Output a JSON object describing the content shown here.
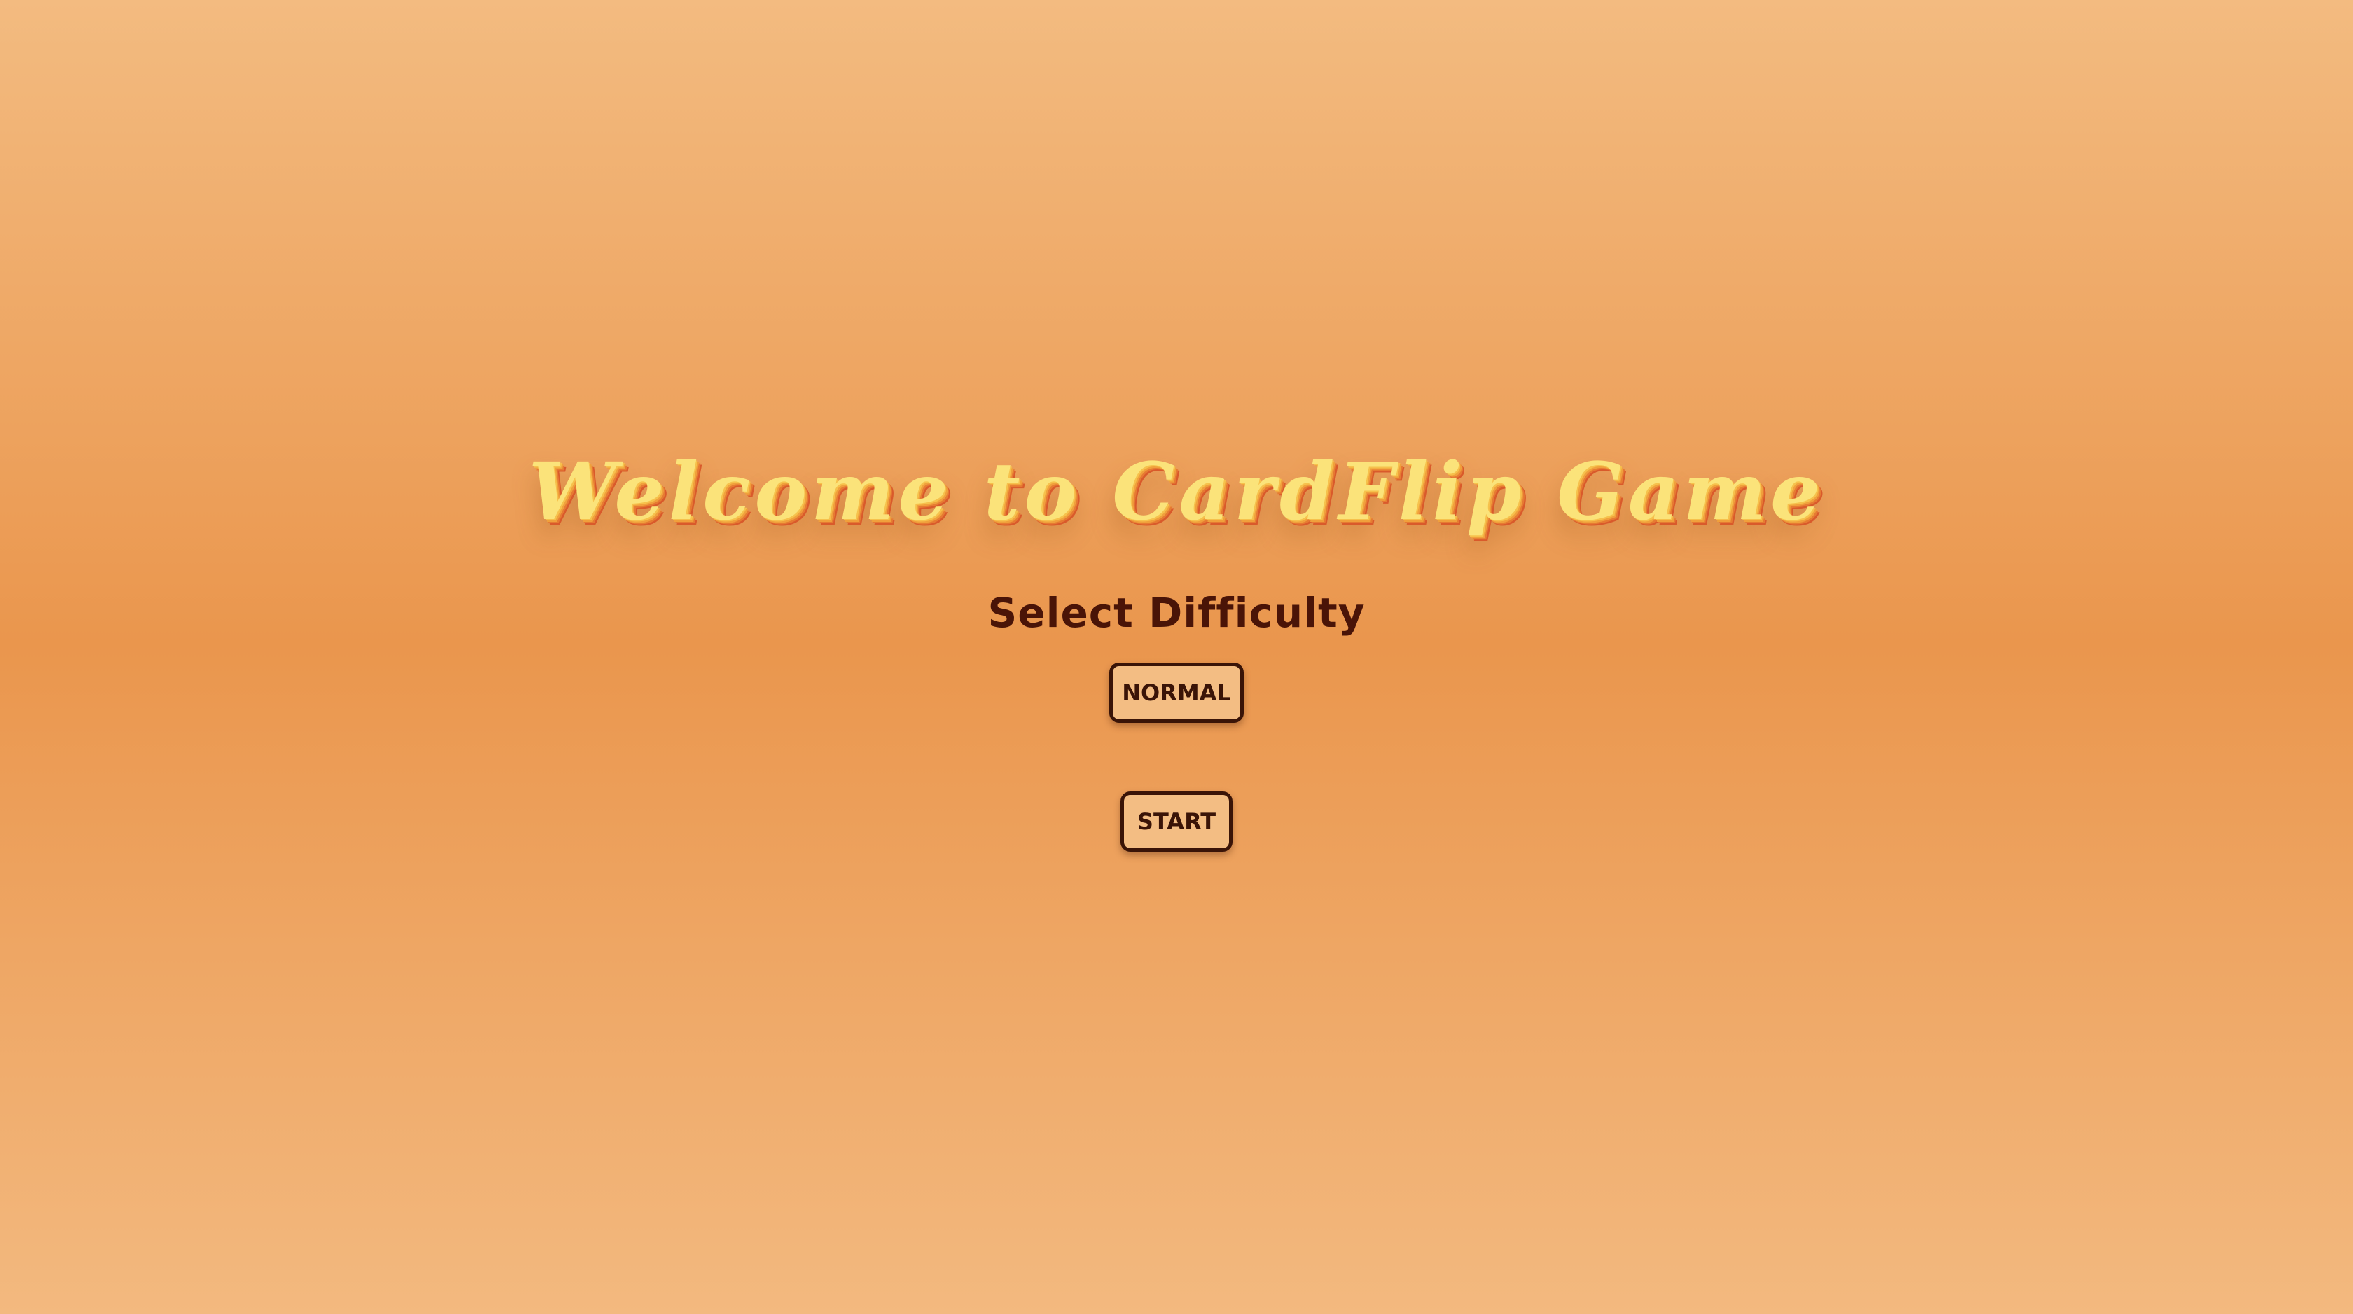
{
  "title": "Welcome to CardFlip Game",
  "difficulty": {
    "heading": "Select Difficulty",
    "selected": "NORMAL"
  },
  "start_label": "START",
  "colors": {
    "background_top": "#f3bb80",
    "background_middle": "#ea964d",
    "title_fill": "#fbe37a",
    "title_extrude": "#d95a2b",
    "text_dark": "#4a1407",
    "button_bg": "#f3bd83",
    "button_border": "#3a1407"
  }
}
